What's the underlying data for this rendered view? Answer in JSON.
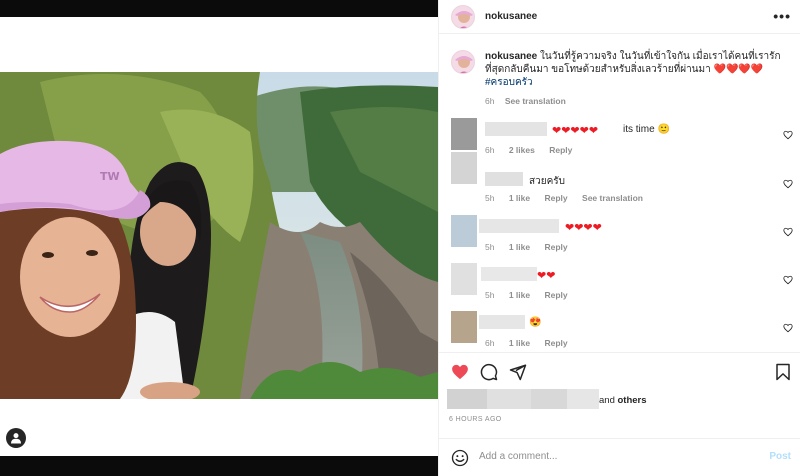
{
  "post": {
    "username": "nokusanee",
    "caption_text": "ในวันที่รู้ความจริง ในวันที่เข้าใจกัน เมื่อเราได้คนที่เรารักที่สุดกลับคืนมา ขอโทษด้วยสำหรับสิ่งเลวร้ายที่ผ่านมา ❤️❤️❤️❤️",
    "hashtag": "#ครอบครัว",
    "caption_time": "6h",
    "see_translation": "See translation",
    "more_label": "•••"
  },
  "comments": [
    {
      "hearts": "❤❤❤❤❤",
      "text": "its time 🙂",
      "time": "6h",
      "likes": "2 likes",
      "reply": "Reply",
      "avatar_color": "#9a9a9a"
    },
    {
      "hearts": "",
      "text": "สวยครับ",
      "time": "5h",
      "likes": "1 like",
      "reply": "Reply",
      "translation": "See translation",
      "avatar_color": "#cfcfcf"
    },
    {
      "hearts": "❤❤❤❤",
      "text": "",
      "time": "5h",
      "likes": "1 like",
      "reply": "Reply",
      "avatar_color": "#b9c9d8"
    },
    {
      "hearts": "❤❤",
      "text": "",
      "time": "5h",
      "likes": "1 like",
      "reply": "Reply",
      "avatar_color": "#d8d8d8"
    },
    {
      "hearts": "",
      "text": "😍",
      "time": "6h",
      "likes": "1 like",
      "reply": "Reply",
      "avatar_color": "#b7a48c"
    }
  ],
  "likes": {
    "and_text": "and",
    "others_text": "others"
  },
  "timestamp": "6 HOURS AGO",
  "add_comment": {
    "placeholder": "Add a comment...",
    "post_label": "Post"
  },
  "colors": {
    "heart_red": "#ed4956",
    "hashtag_blue": "#00376b",
    "post_disabled": "#b2dffc"
  }
}
